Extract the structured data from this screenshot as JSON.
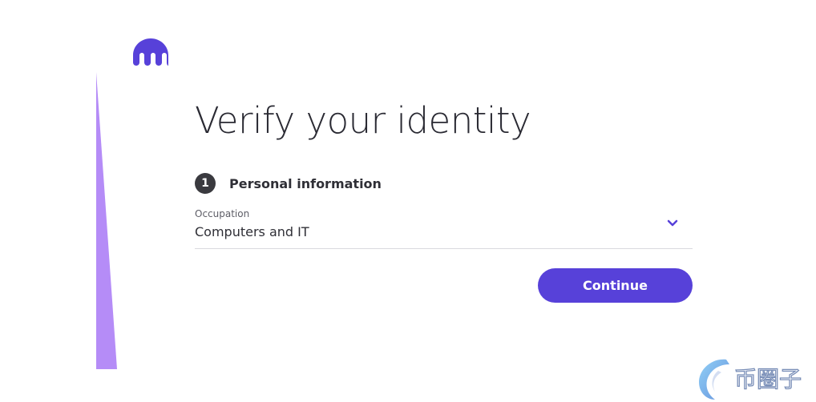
{
  "page": {
    "title": "Verify your identity"
  },
  "brand": {
    "logo_icon": "kraken-logo",
    "accent_color": "#5741d9",
    "side_accent_color": "#b58cf7"
  },
  "step": {
    "number": "1",
    "label": "Personal information"
  },
  "occupation_field": {
    "label": "Occupation",
    "value": "Computers and IT",
    "icon": "chevron-down-icon"
  },
  "actions": {
    "continue_label": "Continue"
  },
  "watermark": {
    "text": "币圈子"
  }
}
